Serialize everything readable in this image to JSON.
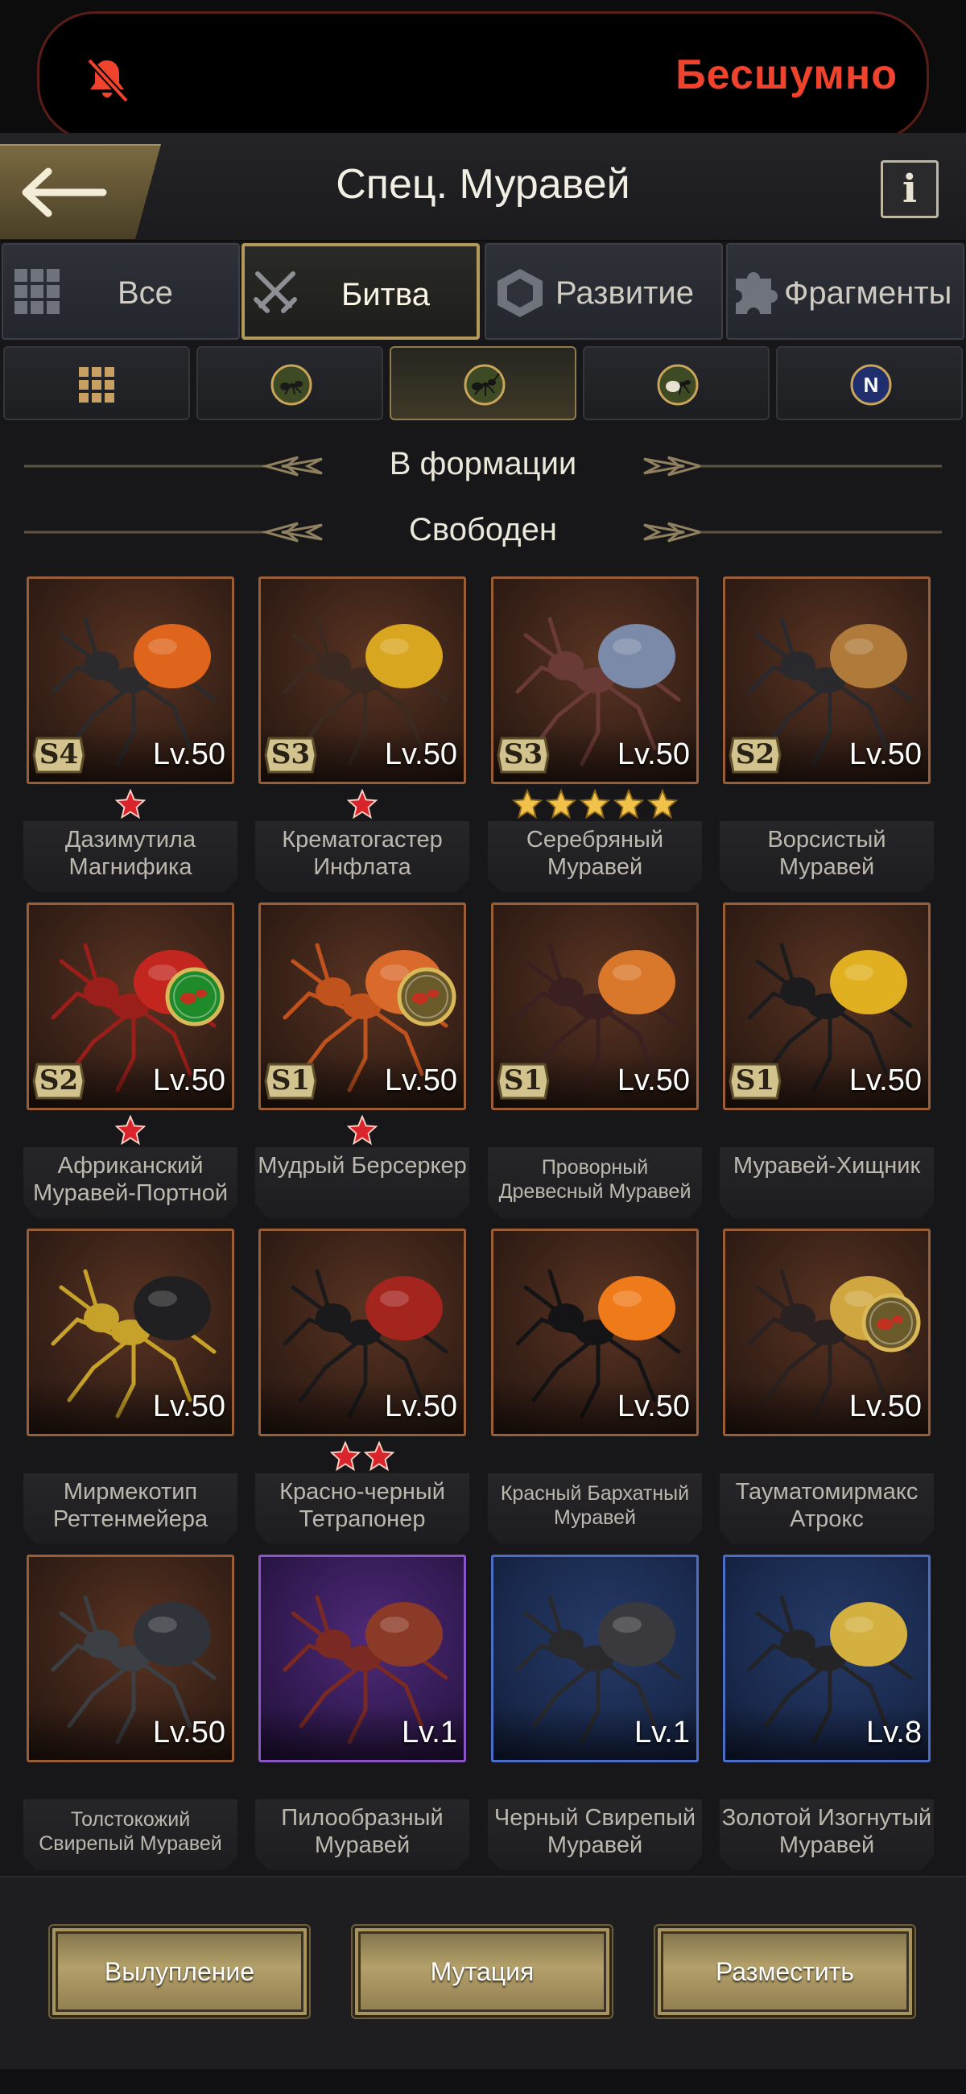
{
  "notification": {
    "text": "Бесшумно",
    "icon": "bell-off-icon",
    "color": "#f0432d"
  },
  "header": {
    "title": "Спец. Муравей",
    "back_icon": "back-arrow-icon",
    "info_label": "i"
  },
  "tabs": [
    {
      "label": "Все",
      "icon": "grid-icon"
    },
    {
      "label": "Битва",
      "icon": "crossed-swords-icon",
      "active": true
    },
    {
      "label": "Развитие",
      "icon": "hexagon-icon"
    },
    {
      "label": "Фрагменты",
      "icon": "puzzle-icon"
    }
  ],
  "subtabs": [
    {
      "icon": "grid-icon"
    },
    {
      "icon": "ant-type-1-icon"
    },
    {
      "icon": "ant-type-2-icon",
      "active": true
    },
    {
      "icon": "ant-type-3-icon"
    },
    {
      "icon": "n-badge-icon",
      "label": "N"
    }
  ],
  "sections": {
    "in_formation": "В формации",
    "free": "Свободен"
  },
  "ants": [
    {
      "name": "Дазимутила Магнифика",
      "level": "Lv.50",
      "rank": "S4",
      "stars": 1,
      "star_color": "red",
      "frame": "bronze"
    },
    {
      "name": "Крематогастер Инфлата",
      "level": "Lv.50",
      "rank": "S3",
      "stars": 1,
      "star_color": "red",
      "frame": "bronze"
    },
    {
      "name": "Серебряный Муравей",
      "level": "Lv.50",
      "rank": "S3",
      "stars": 5,
      "star_color": "gold",
      "frame": "bronze"
    },
    {
      "name": "Ворсистый Муравей",
      "level": "Lv.50",
      "rank": "S2",
      "stars": 0,
      "frame": "bronze"
    },
    {
      "name": "Африканский Муравей-Портной",
      "level": "Lv.50",
      "rank": "S2",
      "stars": 1,
      "star_color": "red",
      "frame": "bronze",
      "badge": "green-skill-icon"
    },
    {
      "name": "Мудрый Берсеркер",
      "level": "Lv.50",
      "rank": "S1",
      "stars": 1,
      "star_color": "red",
      "frame": "bronze",
      "badge": "gold-skill-icon"
    },
    {
      "name": "Проворный Древесный Муравей",
      "level": "Lv.50",
      "rank": "S1",
      "stars": 0,
      "frame": "bronze",
      "small": true
    },
    {
      "name": "Муравей-Хищник",
      "level": "Lv.50",
      "rank": "S1",
      "stars": 0,
      "frame": "bronze"
    },
    {
      "name": "Мирмекотип Реттенмейера",
      "level": "Lv.50",
      "rank": "",
      "stars": 0,
      "frame": "bronze"
    },
    {
      "name": "Красно-черный Тетрапонер",
      "level": "Lv.50",
      "rank": "",
      "stars": 2,
      "star_color": "red",
      "frame": "bronze"
    },
    {
      "name": "Красный Бархатный Муравей",
      "level": "Lv.50",
      "rank": "",
      "stars": 0,
      "frame": "bronze",
      "small": true
    },
    {
      "name": "Тауматомирмакс Атрокс",
      "level": "Lv.50",
      "rank": "",
      "stars": 0,
      "frame": "bronze",
      "badge": "gold-skill-icon"
    },
    {
      "name": "Толстокожий Свирепый Муравей",
      "level": "Lv.50",
      "rank": "",
      "stars": 0,
      "frame": "bronze",
      "small": true
    },
    {
      "name": "Пилообразный Муравей",
      "level": "Lv.1",
      "rank": "",
      "stars": 0,
      "frame": "purple"
    },
    {
      "name": "Черный Свирепый Муравей",
      "level": "Lv.1",
      "rank": "",
      "stars": 0,
      "frame": "blue"
    },
    {
      "name": "Золотой Изогнутый Муравей",
      "level": "Lv.8",
      "rank": "",
      "stars": 0,
      "frame": "blue"
    }
  ],
  "actions": {
    "molt": "Вылупление",
    "mutation": "Мутация",
    "place": "Разместить"
  }
}
